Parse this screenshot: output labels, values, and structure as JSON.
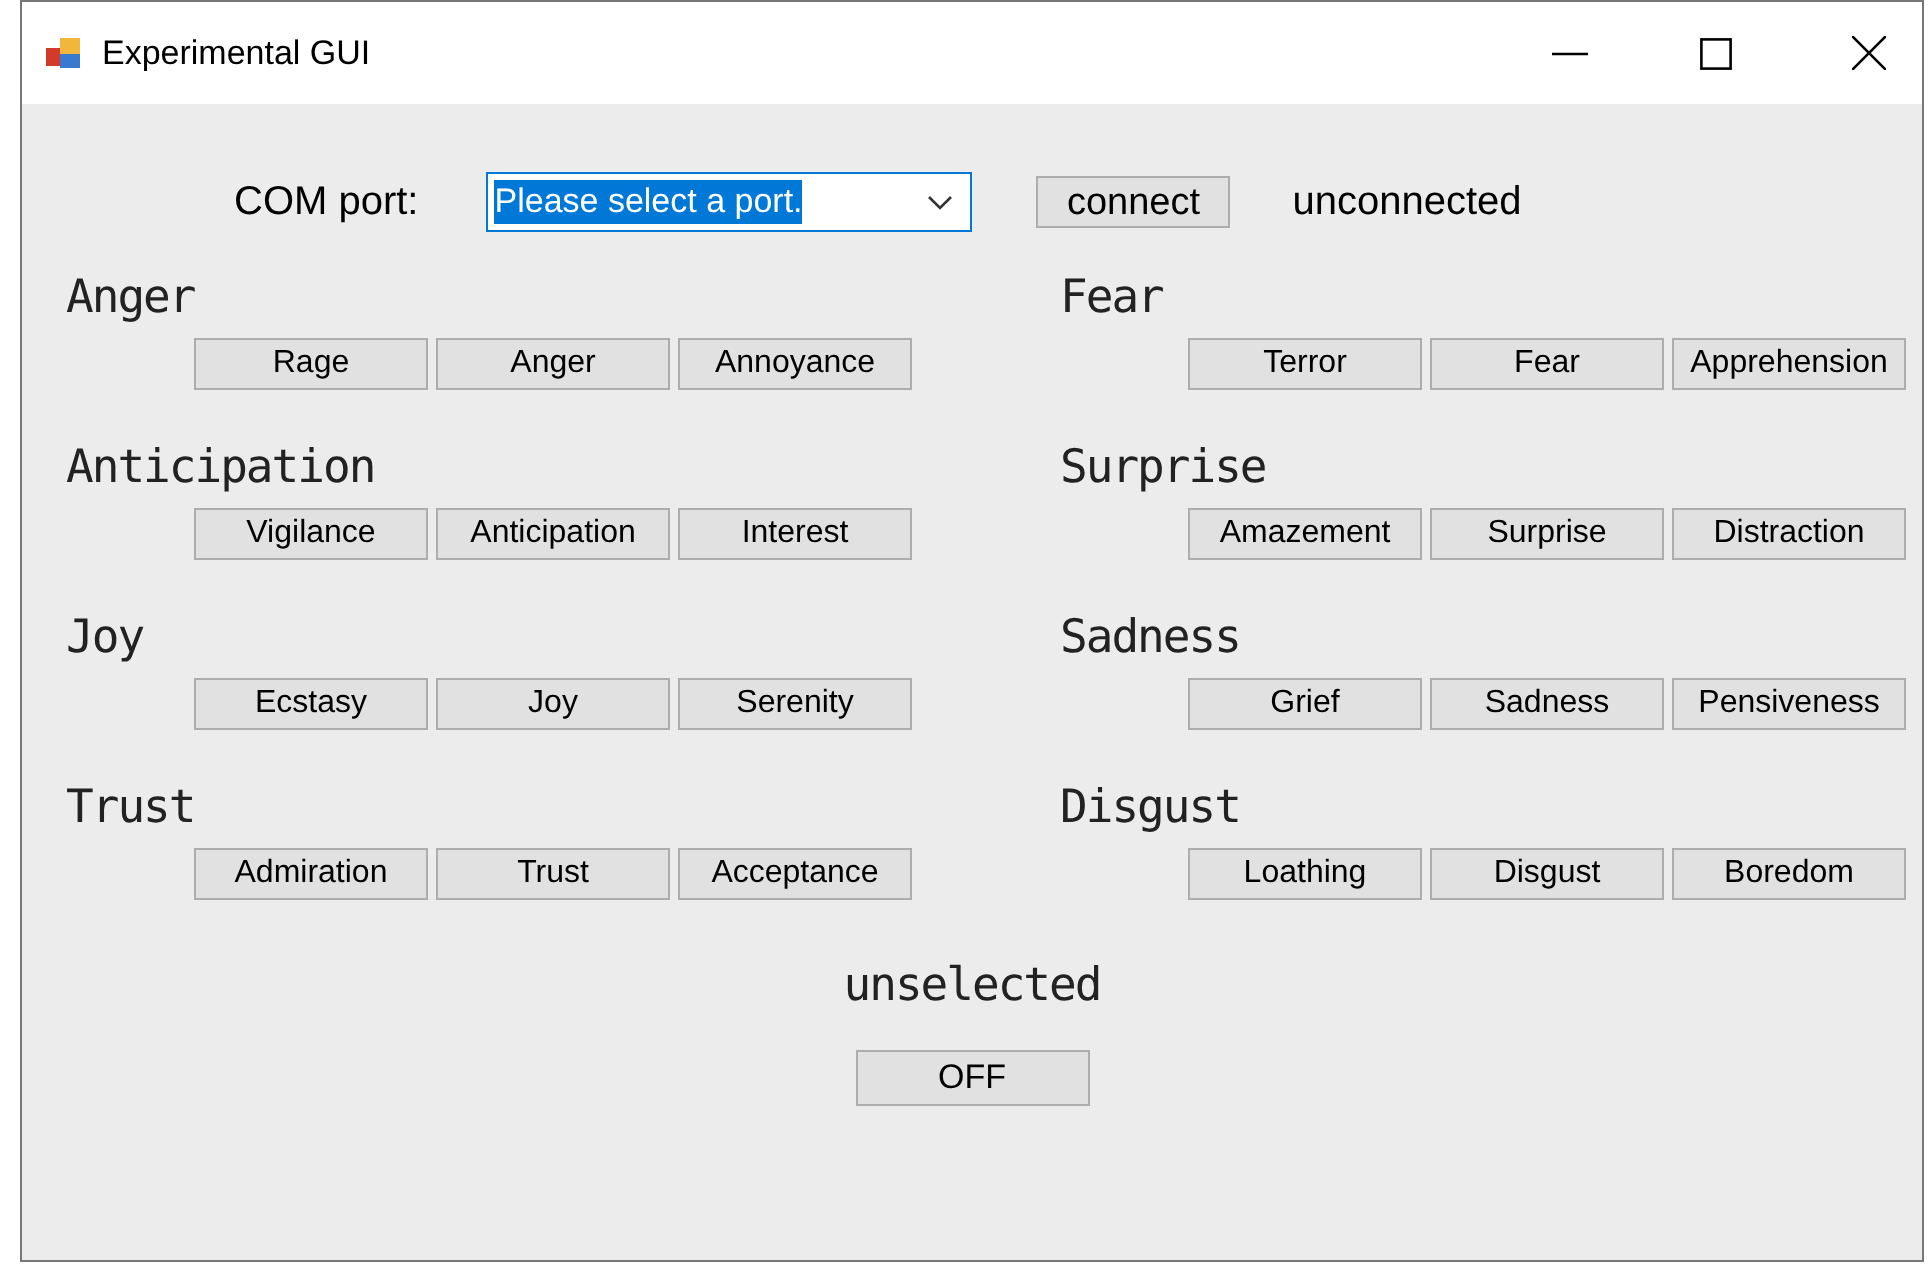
{
  "window": {
    "title": "Experimental GUI"
  },
  "com_port": {
    "label": "COM port:",
    "value": "Please select a port.",
    "text_selected": true
  },
  "connect_button": "connect",
  "connection_status": "unconnected",
  "emotion_groups": [
    {
      "title": "Anger",
      "buttons": [
        "Rage",
        "Anger",
        "Annoyance"
      ]
    },
    {
      "title": "Fear",
      "buttons": [
        "Terror",
        "Fear",
        "Apprehension"
      ]
    },
    {
      "title": "Anticipation",
      "buttons": [
        "Vigilance",
        "Anticipation",
        "Interest"
      ]
    },
    {
      "title": "Surprise",
      "buttons": [
        "Amazement",
        "Surprise",
        "Distraction"
      ]
    },
    {
      "title": "Joy",
      "buttons": [
        "Ecstasy",
        "Joy",
        "Serenity"
      ]
    },
    {
      "title": "Sadness",
      "buttons": [
        "Grief",
        "Sadness",
        "Pensiveness"
      ]
    },
    {
      "title": "Trust",
      "buttons": [
        "Admiration",
        "Trust",
        "Acceptance"
      ]
    },
    {
      "title": "Disgust",
      "buttons": [
        "Loathing",
        "Disgust",
        "Boredom"
      ]
    }
  ],
  "selection_status": "unselected",
  "off_button": "OFF"
}
